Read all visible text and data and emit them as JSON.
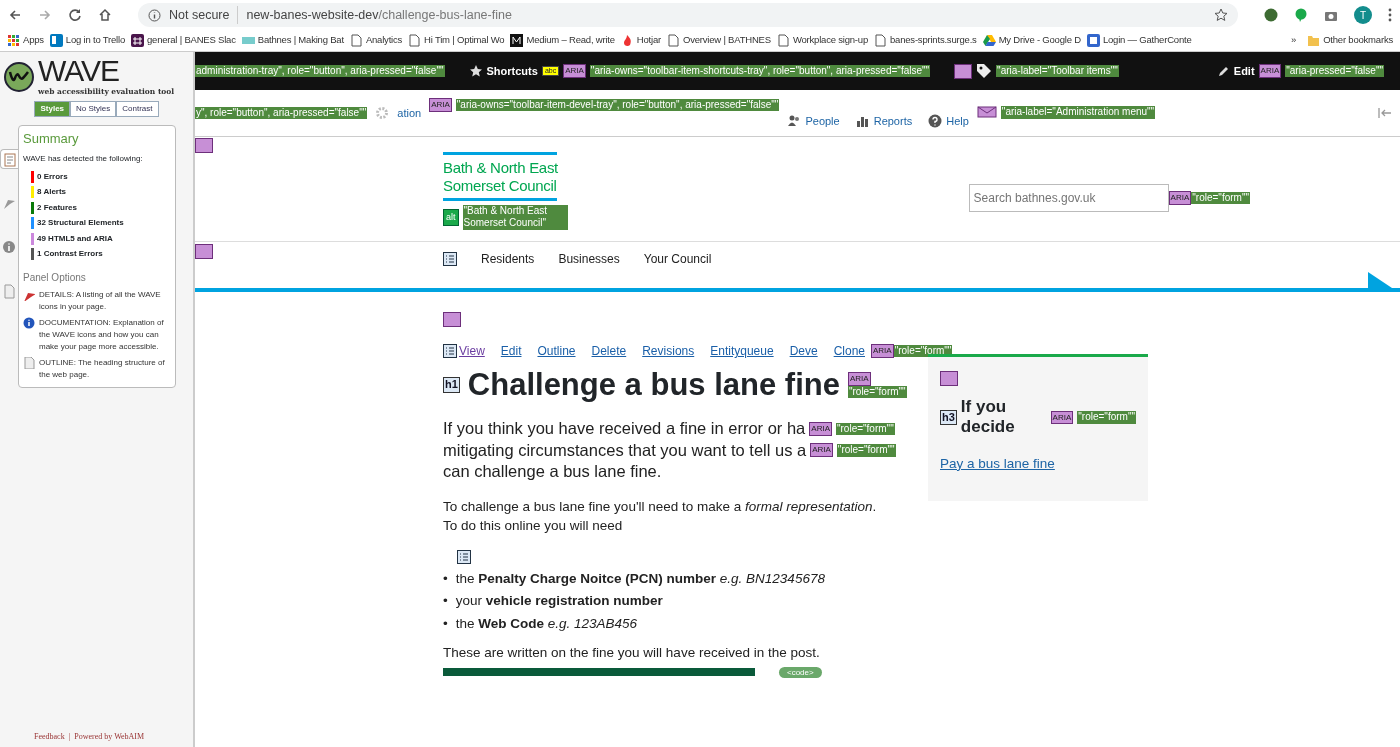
{
  "browser": {
    "security": "Not secure",
    "url_host": "new-banes-website-dev",
    "url_path": "/challenge-bus-lane-fine",
    "profile": "T",
    "bookmarks": [
      {
        "label": "Apps",
        "kind": "apps"
      },
      {
        "label": "Log in to Trello",
        "kind": "trello"
      },
      {
        "label": "general | BANES Slac",
        "kind": "slack"
      },
      {
        "label": "Bathnes | Making Bat",
        "kind": "site"
      },
      {
        "label": "Analytics",
        "kind": "page"
      },
      {
        "label": "Hi Tim | Optimal Wo",
        "kind": "page"
      },
      {
        "label": "Medium – Read, write",
        "kind": "medium"
      },
      {
        "label": "Hotjar",
        "kind": "hotjar"
      },
      {
        "label": "Overview | BATHNES",
        "kind": "page"
      },
      {
        "label": "Workplace sign-up",
        "kind": "page"
      },
      {
        "label": "banes-sprints.surge.s",
        "kind": "page"
      },
      {
        "label": "My Drive - Google D",
        "kind": "drive"
      },
      {
        "label": "Login — GatherConte",
        "kind": "gather"
      }
    ],
    "more": "»",
    "other": "Other bookmarks"
  },
  "wave": {
    "logo": "WAVE",
    "subtitle": "web accessibility evaluation tool",
    "view_tabs": [
      {
        "label": "Styles",
        "selected": true
      },
      {
        "label": "No Styles",
        "selected": false
      },
      {
        "label": "Contrast",
        "selected": false
      }
    ],
    "side_tabs": [
      {
        "kind": "summary",
        "selected": true
      },
      {
        "kind": "details",
        "selected": false
      },
      {
        "kind": "documentation",
        "selected": false
      },
      {
        "kind": "outline",
        "selected": false
      }
    ],
    "summary": {
      "title": "Summary",
      "intro": "WAVE has detected the following:",
      "items": [
        {
          "label": "0 Errors",
          "color": "#ff0000"
        },
        {
          "label": "8 Alerts",
          "color": "#ffee00"
        },
        {
          "label": "2 Features",
          "color": "#087a08"
        },
        {
          "label": "32 Structural Elements",
          "color": "#1e90ff"
        },
        {
          "label": "49 HTML5 and ARIA",
          "color": "#cc88dd"
        },
        {
          "label": "1 Contrast Errors",
          "color": "#555555"
        }
      ]
    },
    "panel_options": {
      "title": "Panel Options",
      "items": [
        {
          "kind": "details",
          "text": "DETAILS: A listing of all the WAVE icons in your page."
        },
        {
          "kind": "documentation",
          "text": "DOCUMENTATION: Explanation of the WAVE icons and how you can make your page more accessible."
        },
        {
          "kind": "outline",
          "text": "OUTLINE: The heading structure of the web page."
        }
      ]
    },
    "footer": {
      "feedback": "Feedback",
      "separator": "|",
      "powered": "Powered by",
      "webaim": "WebAIM"
    }
  },
  "admin_bar": {
    "tray_note": "administration-tray\", role=\"button\", aria-pressed=\"false\"\"",
    "shortcuts": "Shortcuts",
    "shortcuts_badge": "abc",
    "shortcuts_aria": "ARIA",
    "shortcuts_note": "\"aria-owns=\"toolbar-item-shortcuts-tray\", role=\"button\", aria-pressed=\"false\"\"",
    "items_note": "\"aria-label=\"Toolbar items\"\"",
    "edit": "Edit",
    "edit_aria": "ARIA",
    "edit_note": "\"aria-pressed=\"false\"\""
  },
  "admin_tray": {
    "left_note": "y\", role=\"button\", aria-pressed=\"false\"\"",
    "partial": "ation",
    "devel_aria": "ARIA",
    "devel_note": "\"aria-owns=\"toolbar-item-devel-tray\", role=\"button\", aria-pressed=\"false\"\"",
    "people": "People",
    "reports": "Reports",
    "help": "Help",
    "menu_note": "\"aria-label=\"Administration menu\"\""
  },
  "header": {
    "logo_lines": [
      "Bath & North East",
      "Somerset Council"
    ],
    "alt_badge": "alt",
    "alt_note": "\"Bath & North East Somerset Council\"",
    "search_placeholder": "Search bathnes.gov.uk",
    "search_aria": "ARIA",
    "search_note": "\"role=\"form\"\""
  },
  "nav": [
    "Residents",
    "Businesses",
    "Your Council"
  ],
  "tabs": [
    {
      "label": "View",
      "selected": true
    },
    {
      "label": "Edit",
      "selected": false
    },
    {
      "label": "Outline",
      "selected": false
    },
    {
      "label": "Delete",
      "selected": false
    },
    {
      "label": "Revisions",
      "selected": false
    },
    {
      "label": "Entityqueue",
      "selected": false
    },
    {
      "label": "Deve",
      "selected": false
    },
    {
      "label": "Clone",
      "selected": false
    }
  ],
  "tabs_aria": {
    "badge": "ARIA",
    "note": "\"role=\"form\"\""
  },
  "heading": {
    "badge": "h1",
    "text": "Challenge a bus lane fine",
    "aria": "ARIA",
    "note": "\"role=\"form\"\""
  },
  "intro_lines": [
    {
      "text": "If you think you have received a fine in error or ha",
      "aria": "ARIA",
      "note": "\"role=\"form\"\""
    },
    {
      "text": "mitigating circumstances that you want to tell us a",
      "aria": "ARIA",
      "note": "\"role=\"form\"\""
    },
    {
      "text": "can challenge a bus lane fine."
    }
  ],
  "body_lines": [
    "To challenge a bus lane fine you'll need to make a *formal representation*.",
    "To do this online you will need"
  ],
  "list": [
    {
      "marker": "•",
      "text": "the **Penalty Charge Noitce (PCN) number** *e.g. BN12345678*"
    },
    {
      "marker": "•",
      "text": "your **vehicle registration number**"
    },
    {
      "marker": "•",
      "text": "the **Web Code** *e.g. 123AB456*"
    }
  ],
  "closing": "These are written on the fine you will have received in the post.",
  "code_badge": "<code>",
  "aside": {
    "badge": "h3",
    "heading": "If you decide",
    "aria": "ARIA",
    "note": "\"role=\"form\"\"",
    "link": "Pay a bus lane fine"
  }
}
